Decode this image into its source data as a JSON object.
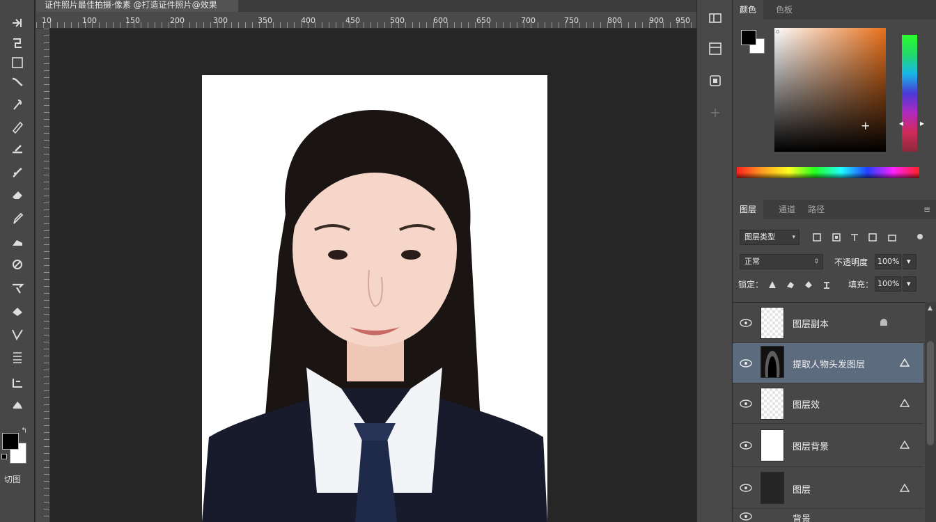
{
  "document_tab": {
    "title": "证件照片最佳拍摄·像素 @打造证件照片@效果"
  },
  "ruler": {
    "top_labels": [
      "10",
      "100",
      "150",
      "200",
      "300",
      "350",
      "400",
      "450",
      "500",
      "600",
      "650",
      "700",
      "750",
      "800",
      "900",
      "950"
    ]
  },
  "toolbar": {
    "tools": [
      "move-tool",
      "lasso-tool",
      "marquee-tool",
      "brush-tool",
      "healing-tool",
      "pencil-tool",
      "clone-tool",
      "history-brush-tool",
      "eraser-tool",
      "bucket-tool",
      "dodge-tool",
      "pen-tool",
      "text-tool",
      "path-select-tool",
      "shape-tool",
      "crop-tool",
      "hand-tool"
    ],
    "quick_mask_label": "切图",
    "foreground": "#000000",
    "background": "#ffffff"
  },
  "color_panel": {
    "tabs": [
      "颜色",
      "色板"
    ],
    "foreground": "#000000",
    "background": "#ffffff",
    "hue": "#e8701a"
  },
  "layers_panel": {
    "tabs": [
      "图层",
      "通道",
      "路径"
    ],
    "kind_filter": "图层类型",
    "blend_mode": "正常",
    "opacity_label": "不透明度",
    "opacity_value": "100%",
    "lock_label": "锁定：",
    "fill_label": "填充：",
    "fill_value": "100%",
    "layers": [
      {
        "name": "图层副本",
        "thumb": "checker",
        "selected": false
      },
      {
        "name": "提取人物头发图层",
        "thumb": "hair",
        "selected": true
      },
      {
        "name": "图层效",
        "thumb": "checker",
        "selected": false
      },
      {
        "name": "图层背景",
        "thumb": "white",
        "selected": false
      },
      {
        "name": "图层",
        "thumb": "dark",
        "selected": false
      },
      {
        "name": "背景",
        "thumb": "none",
        "selected": false
      }
    ]
  },
  "colors": {
    "selection": "#5d6b7e",
    "canvas_bg": "#262626",
    "panel_bg": "#474747"
  }
}
